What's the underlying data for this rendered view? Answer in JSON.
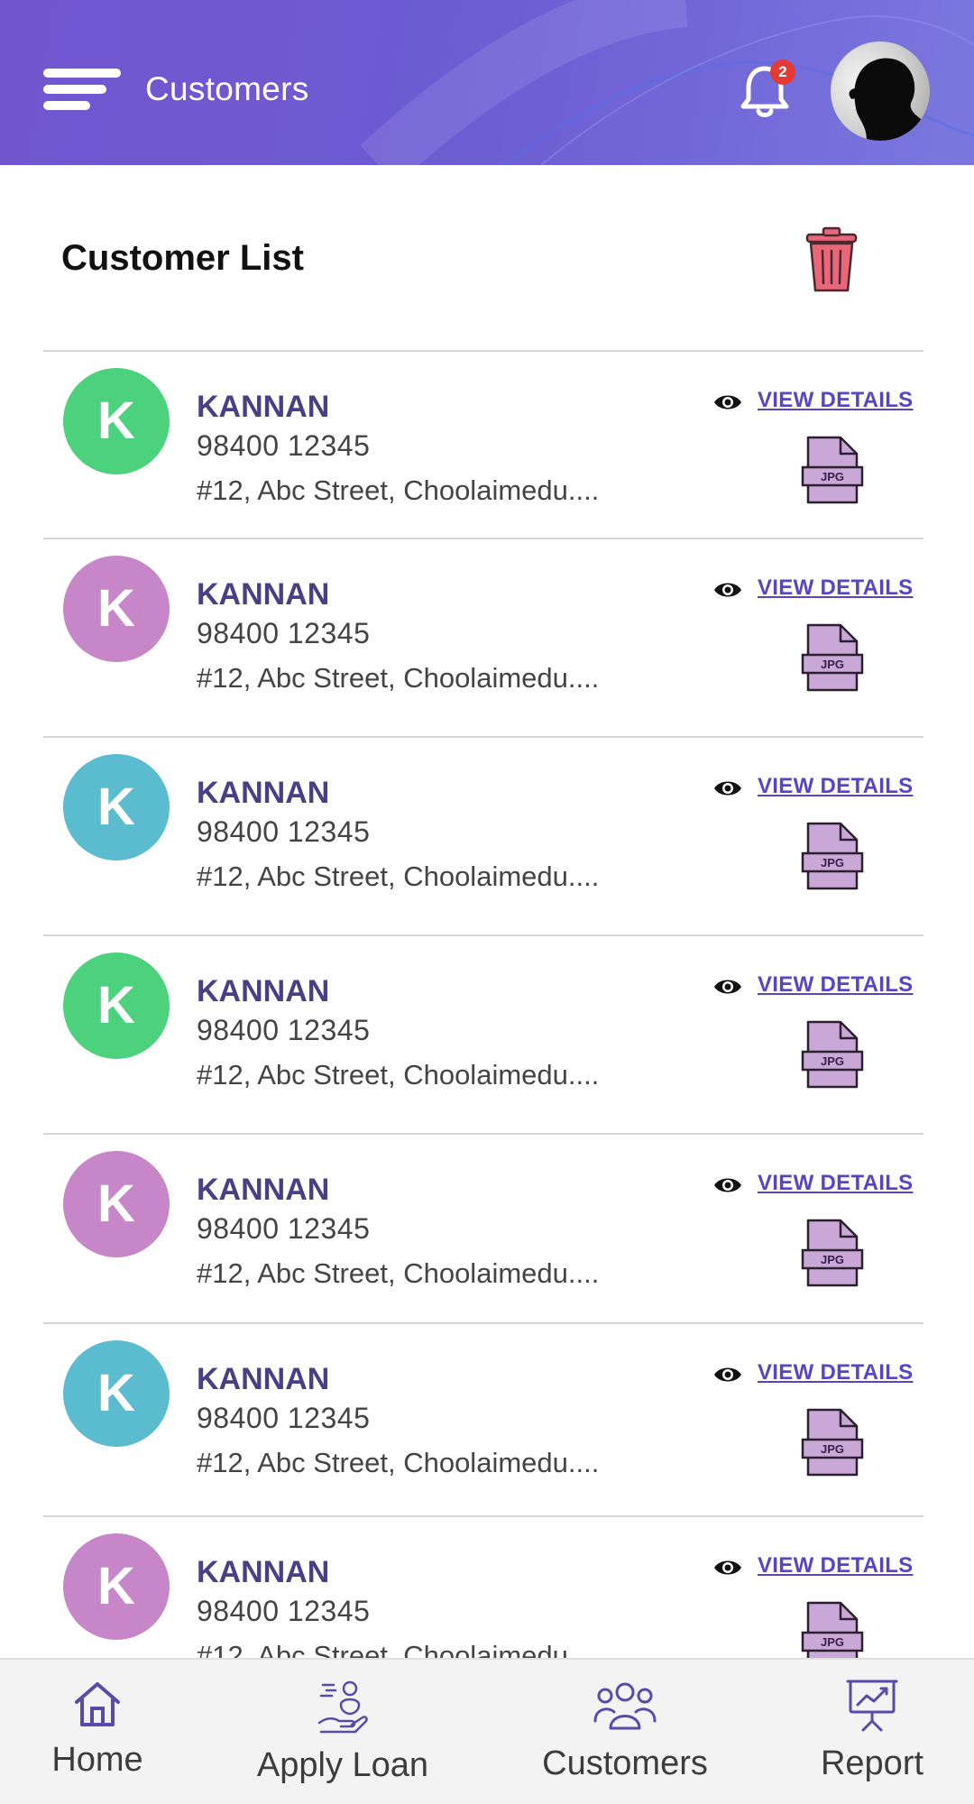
{
  "header": {
    "title": "Customers",
    "notification_count": "2"
  },
  "section": {
    "title": "Customer List"
  },
  "customers": [
    {
      "initial": "K",
      "name": "KANNAN",
      "phone": "98400 12345",
      "address": "#12, Abc Street, Choolaimedu....",
      "action_label": "VIEW DETAILS",
      "file_label": "JPG",
      "color": "#4cd17c"
    },
    {
      "initial": "K",
      "name": "KANNAN",
      "phone": "98400 12345",
      "address": "#12, Abc Street, Choolaimedu....",
      "action_label": "VIEW DETAILS",
      "file_label": "JPG",
      "color": "#c786c8"
    },
    {
      "initial": "K",
      "name": "KANNAN",
      "phone": "98400 12345",
      "address": "#12, Abc Street, Choolaimedu....",
      "action_label": "VIEW DETAILS",
      "file_label": "JPG",
      "color": "#5bbccf"
    },
    {
      "initial": "K",
      "name": "KANNAN",
      "phone": "98400 12345",
      "address": "#12, Abc Street, Choolaimedu....",
      "action_label": "VIEW DETAILS",
      "file_label": "JPG",
      "color": "#4cd17c"
    },
    {
      "initial": "K",
      "name": "KANNAN",
      "phone": "98400 12345",
      "address": "#12, Abc Street, Choolaimedu....",
      "action_label": "VIEW DETAILS",
      "file_label": "JPG",
      "color": "#c786c8"
    },
    {
      "initial": "K",
      "name": "KANNAN",
      "phone": "98400 12345",
      "address": "#12, Abc Street, Choolaimedu....",
      "action_label": "VIEW DETAILS",
      "file_label": "JPG",
      "color": "#5bbccf"
    },
    {
      "initial": "K",
      "name": "KANNAN",
      "phone": "98400 12345",
      "address": "#12, Abc Street, Choolaimedu....",
      "action_label": "VIEW DETAILS",
      "file_label": "JPG",
      "color": "#c786c8"
    }
  ],
  "bottom_nav": [
    {
      "label": "Home",
      "icon": "home-icon"
    },
    {
      "label": "Apply Loan",
      "icon": "apply-loan-icon"
    },
    {
      "label": "Customers",
      "icon": "customers-icon"
    },
    {
      "label": "Report",
      "icon": "report-icon"
    }
  ],
  "colors": {
    "header": "#6f56cf",
    "name_text": "#4a3f85",
    "link": "#5a44c6",
    "nav_icon": "#5a4aa8",
    "trash": "#e8687a"
  }
}
